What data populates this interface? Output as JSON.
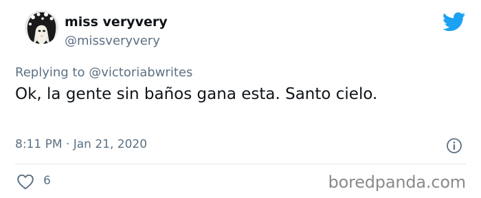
{
  "user": {
    "display_name": "miss veryvery",
    "handle": "@missveryvery"
  },
  "reply": {
    "prefix": "Replying to",
    "mention": "@victoriabwrites"
  },
  "tweet": {
    "text": "Ok, la gente sin baños gana esta. Santo cielo.",
    "timestamp": "8:11 PM · Jan 21, 2020"
  },
  "actions": {
    "like_count": "6"
  },
  "icons": {
    "brand": "twitter-bird-icon",
    "info": "info-icon",
    "like": "heart-outline-icon"
  },
  "watermark": "boredpanda.com",
  "colors": {
    "twitter_blue": "#1da1f2",
    "secondary_text": "#5b7083",
    "primary_text": "#0f1419",
    "divider": "#e1e8ed"
  }
}
